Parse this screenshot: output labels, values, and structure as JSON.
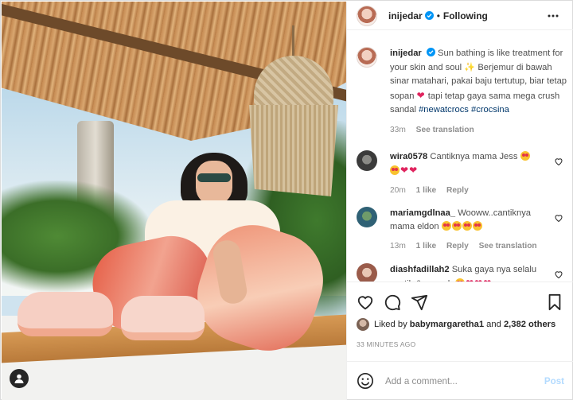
{
  "header": {
    "username": "inijedar",
    "separator": "•",
    "follow_status": "Following"
  },
  "caption": {
    "username": "inijedar",
    "text_1": "Sun bathing is like treatment for your skin and soul",
    "text_2": "Berjemur di bawah sinar matahari, pakai baju tertutup, biar tetap sopan",
    "text_3": "tapi tetap gaya sama mega crush sandal",
    "hashtag_1": "#newatcrocs",
    "hashtag_2": "#crocsina",
    "time": "33m",
    "see_translation": "See translation"
  },
  "comments": [
    {
      "username": "wira0578",
      "text": "Cantiknya mama Jess",
      "time": "20m",
      "likes": "1 like",
      "reply": "Reply"
    },
    {
      "username": "mariamgdlnaa_",
      "text": "Wooww..cantiknya mama eldon",
      "time": "13m",
      "likes": "1 like",
      "reply": "Reply",
      "see_translation": "See translation"
    },
    {
      "username": "diashfadillah2",
      "text": "Suka gaya nya selalu cantik & mewah"
    }
  ],
  "likes": {
    "prefix": "Liked by",
    "user": "babymargaretha1",
    "suffix": "and",
    "count": "2,382 others"
  },
  "timestamp": "33 MINUTES AGO",
  "add_comment": {
    "placeholder": "Add a comment...",
    "post_label": "Post"
  },
  "colors": {
    "verified": "#0095f6",
    "post_disabled": "#b3dbff",
    "hashtag": "#00376b"
  },
  "icons": [
    "verified-icon",
    "more-icon",
    "heart-icon",
    "comment-icon",
    "share-icon",
    "bookmark-icon",
    "emoji-icon",
    "user-tag-icon"
  ]
}
